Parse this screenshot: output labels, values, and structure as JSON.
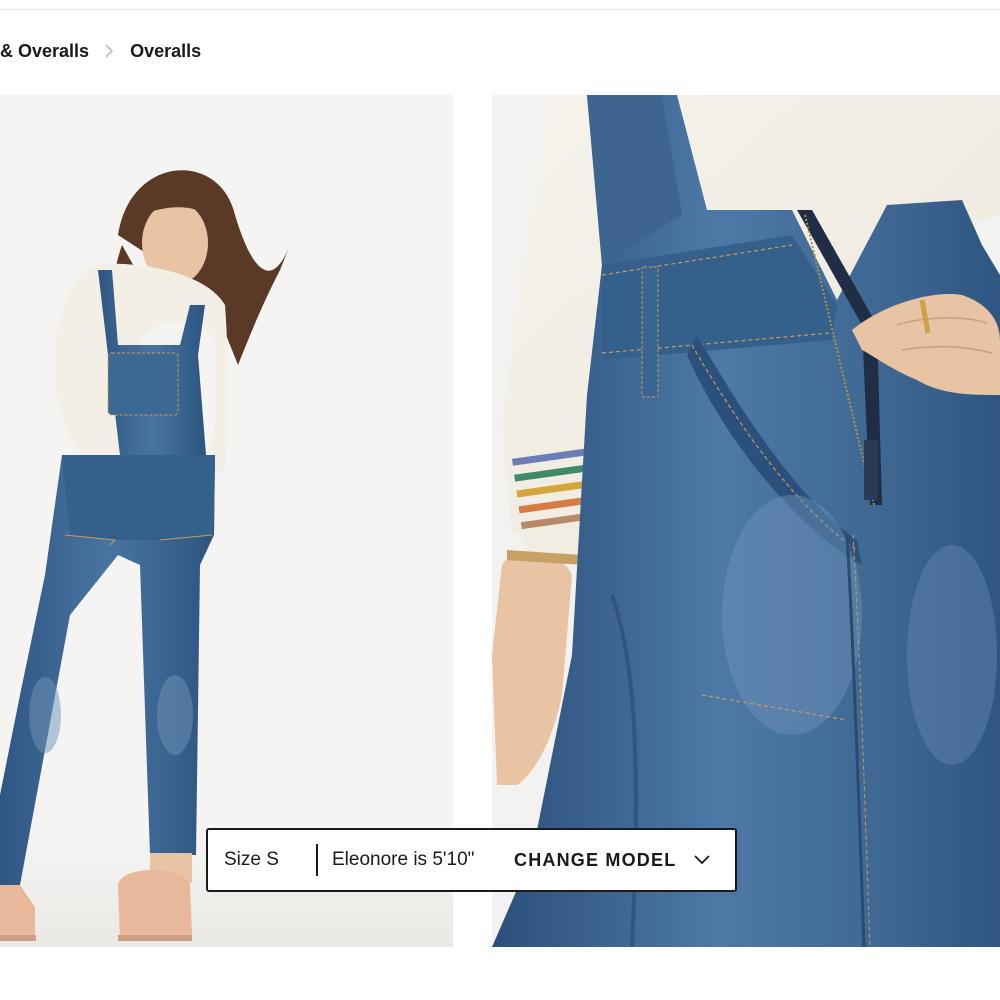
{
  "breadcrumb": {
    "parent": "& Overalls",
    "current": "Overalls"
  },
  "gallery": {
    "images": [
      {
        "alt": "model-full-body-photo"
      },
      {
        "alt": "overalls-detail-photo"
      }
    ]
  },
  "model_selector": {
    "size_label": "Size S",
    "model_info": "Eleonore is 5'10\"",
    "change_label": "CHANGE MODEL",
    "icon": "chevron-down-icon"
  },
  "colors": {
    "denim": "#3d6590",
    "denim_dark": "#2a4a70",
    "sweater": "#f3efe6",
    "text": "#1a1a1a"
  }
}
